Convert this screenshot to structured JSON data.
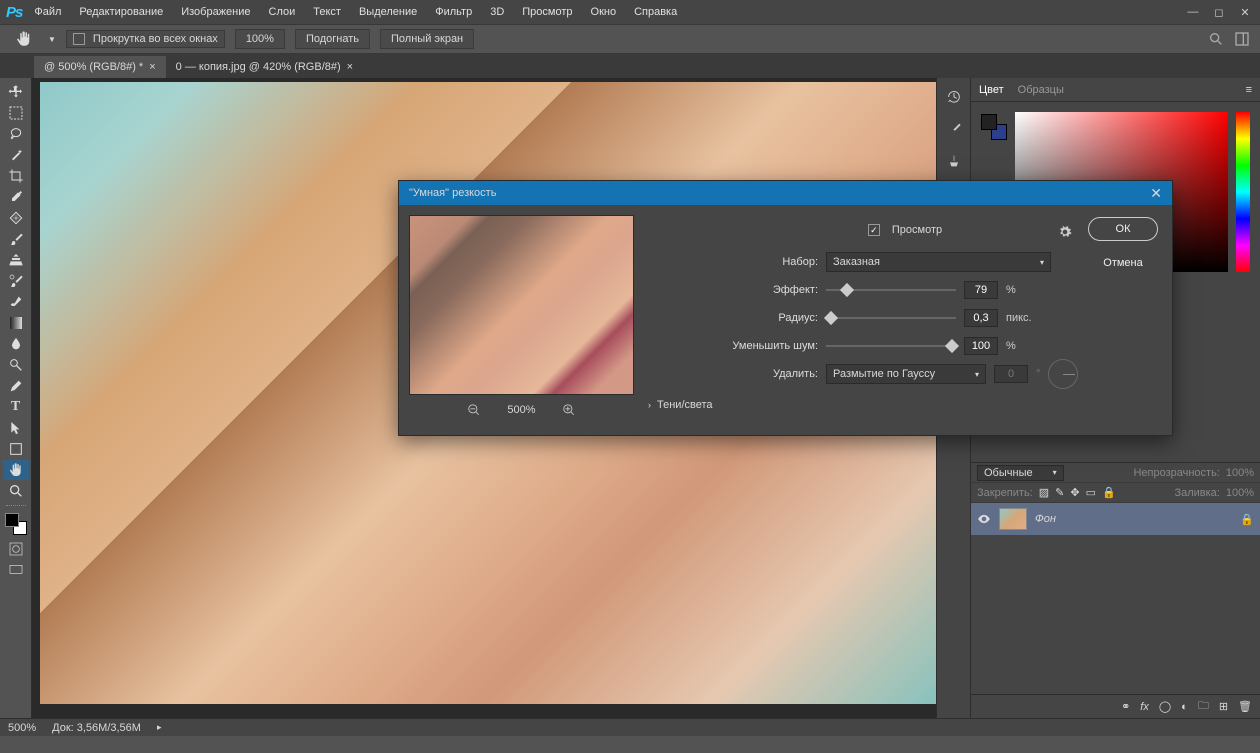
{
  "menu": {
    "items": [
      "Файл",
      "Редактирование",
      "Изображение",
      "Слои",
      "Текст",
      "Выделение",
      "Фильтр",
      "3D",
      "Просмотр",
      "Окно",
      "Справка"
    ]
  },
  "options": {
    "scroll_all": "Прокрутка во всех окнах",
    "zoom_value": "100%",
    "fit": "Подогнать",
    "fullscreen": "Полный экран"
  },
  "tabs": [
    {
      "label": "@ 500% (RGB/8#) *",
      "active": true
    },
    {
      "label": "0 — копия.jpg @ 420% (RGB/8#)",
      "active": false
    }
  ],
  "color_panel": {
    "tabs": [
      "Цвет",
      "Образцы"
    ],
    "active": 0
  },
  "layers_panel": {
    "tabs": [
      "Обычные"
    ],
    "opacity_label": "Непрозрачность:",
    "opacity_val": "100%",
    "lock_label": "Закрепить:",
    "fill_label": "Заливка:",
    "fill_val": "100%",
    "layer_name": "Фон"
  },
  "status": {
    "zoom": "500%",
    "doc": "Док: 3,56M/3,56M"
  },
  "dialog": {
    "title": "\"Умная\" резкость",
    "preview_label": "Просмотр",
    "preset_label": "Набор:",
    "preset_value": "Заказная",
    "amount_label": "Эффект:",
    "amount_value": "79",
    "amount_unit": "%",
    "radius_label": "Радиус:",
    "radius_value": "0,3",
    "radius_unit": "пикс.",
    "noise_label": "Уменьшить шум:",
    "noise_value": "100",
    "noise_unit": "%",
    "remove_label": "Удалить:",
    "remove_value": "Размытие по Гауссу",
    "angle_value": "0",
    "angle_unit": "°",
    "ok": "ОК",
    "cancel": "Отмена",
    "zoom": "500%",
    "shadows": "Тени/света"
  }
}
